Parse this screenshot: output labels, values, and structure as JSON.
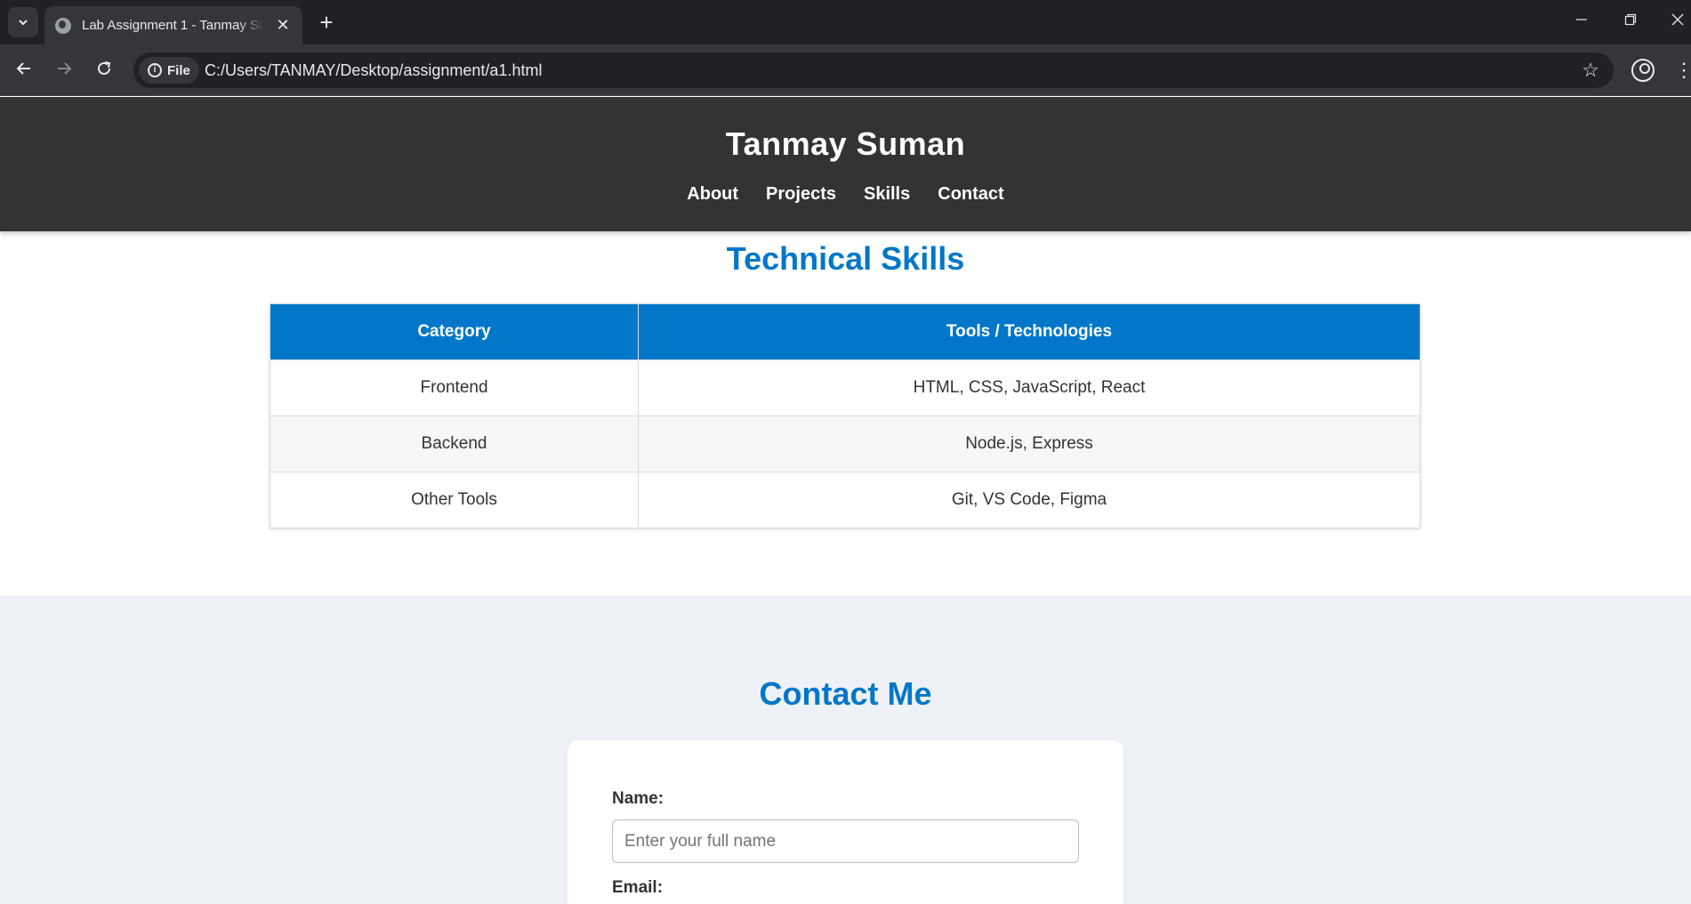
{
  "browser": {
    "tab_title": "Lab Assignment 1 - Tanmay Suman",
    "tab_close": "✕",
    "new_tab": "+",
    "site_chip": "File",
    "url": "C:/Users/TANMAY/Desktop/assignment/a1.html",
    "icons": [
      "tab-search-icon",
      "globe-icon",
      "close-icon",
      "plus-icon",
      "minimize-icon",
      "restore-icon",
      "window-close-icon",
      "back-arrow-icon",
      "forward-arrow-icon",
      "reload-icon",
      "info-icon",
      "star-icon",
      "profile-icon",
      "kebab-menu-icon"
    ]
  },
  "header": {
    "title": "Tanmay Suman",
    "nav": [
      "About",
      "Projects",
      "Skills",
      "Contact"
    ]
  },
  "skills": {
    "title": "Technical Skills",
    "columns": [
      "Category",
      "Tools / Technologies"
    ],
    "rows": [
      [
        "Frontend",
        "HTML, CSS, JavaScript, React"
      ],
      [
        "Backend",
        "Node.js, Express"
      ],
      [
        "Other Tools",
        "Git, VS Code, Figma"
      ]
    ]
  },
  "contact": {
    "title": "Contact Me",
    "name_label": "Name:",
    "name_placeholder": "Enter your full name",
    "name_value": "",
    "email_label": "Email:"
  },
  "colors": {
    "accent": "#0277c9",
    "header_bg": "#333333",
    "contact_bg": "#eef2f6"
  }
}
